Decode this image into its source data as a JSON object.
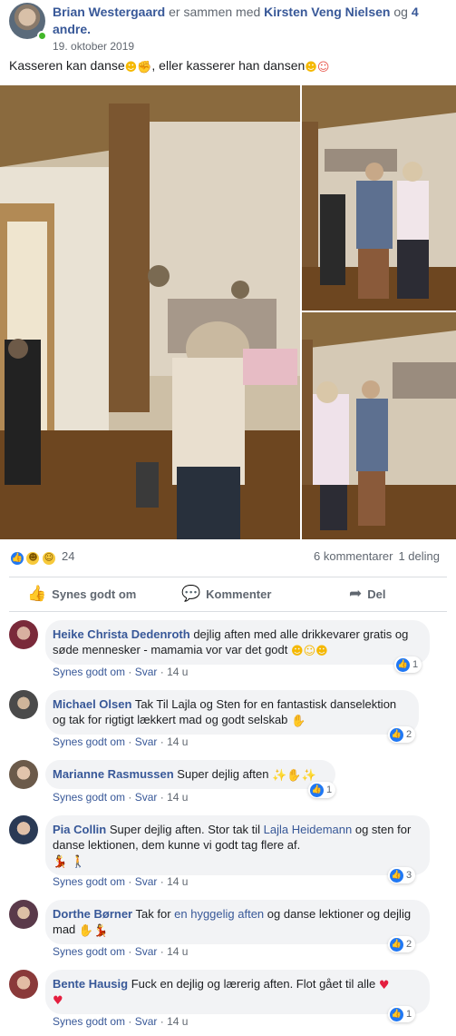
{
  "post": {
    "author": "Brian Westergaard",
    "with_text": " er sammen med ",
    "tagged": "Kirsten Veng Nielsen",
    "and_text": " og ",
    "others": "4 andre.",
    "date": "19. oktober 2019",
    "caption_part1": "Kasseren kan danse",
    "caption_part2": ", eller kasserer han dansen"
  },
  "stats": {
    "reaction_count": "24",
    "comments": "6 kommentarer",
    "shares": "1 deling"
  },
  "actions": {
    "like": "Synes godt om",
    "comment": "Kommenter",
    "share": "Del"
  },
  "comments": [
    {
      "name": "Heike Christa Dedenroth",
      "text": "dejlig aften med alle drikkevarer gratis og søde mennesker - mamamia vor var det godt",
      "like": "Synes godt om",
      "reply": "Svar",
      "time": "14 u",
      "reactions": "1"
    },
    {
      "name": "Michael Olsen",
      "text": "Tak Til Lajla og Sten for en fantastisk danselektion og tak for rigtigt lækkert mad og godt selskab",
      "like": "Synes godt om",
      "reply": "Svar",
      "time": "14 u",
      "reactions": "2"
    },
    {
      "name": "Marianne Rasmussen",
      "text": "Super dejlig aften",
      "like": "Synes godt om",
      "reply": "Svar",
      "time": "14 u",
      "reactions": "1"
    },
    {
      "name": "Pia Collin",
      "text_a": "Super dejlig aften. Stor tak til ",
      "tag": "Lajla Heidemann",
      "text_b": " og sten for danse lektionen, dem kunne vi godt tag flere af.",
      "like": "Synes godt om",
      "reply": "Svar",
      "time": "14 u",
      "reactions": "3"
    },
    {
      "name": "Dorthe Børner",
      "text_a": "Tak for ",
      "tag": "en hyggelig aften",
      "text_b": " og danse lektioner og dejlig mad",
      "like": "Synes godt om",
      "reply": "Svar",
      "time": "14 u",
      "reactions": "2"
    },
    {
      "name": "Bente Hausig",
      "text": "Fuck en dejlig og lærerig aften. Flot gået til alle",
      "like": "Synes godt om",
      "reply": "Svar",
      "time": "14 u",
      "reactions": "1"
    }
  ],
  "icons": {
    "like": "thumbs-up-icon",
    "comment": "speech-bubble-icon",
    "share": "share-arrow-icon"
  },
  "colors": {
    "link": "#385898",
    "meta": "#606770",
    "bubble": "#f2f3f5",
    "like_blue": "#2078f4"
  }
}
